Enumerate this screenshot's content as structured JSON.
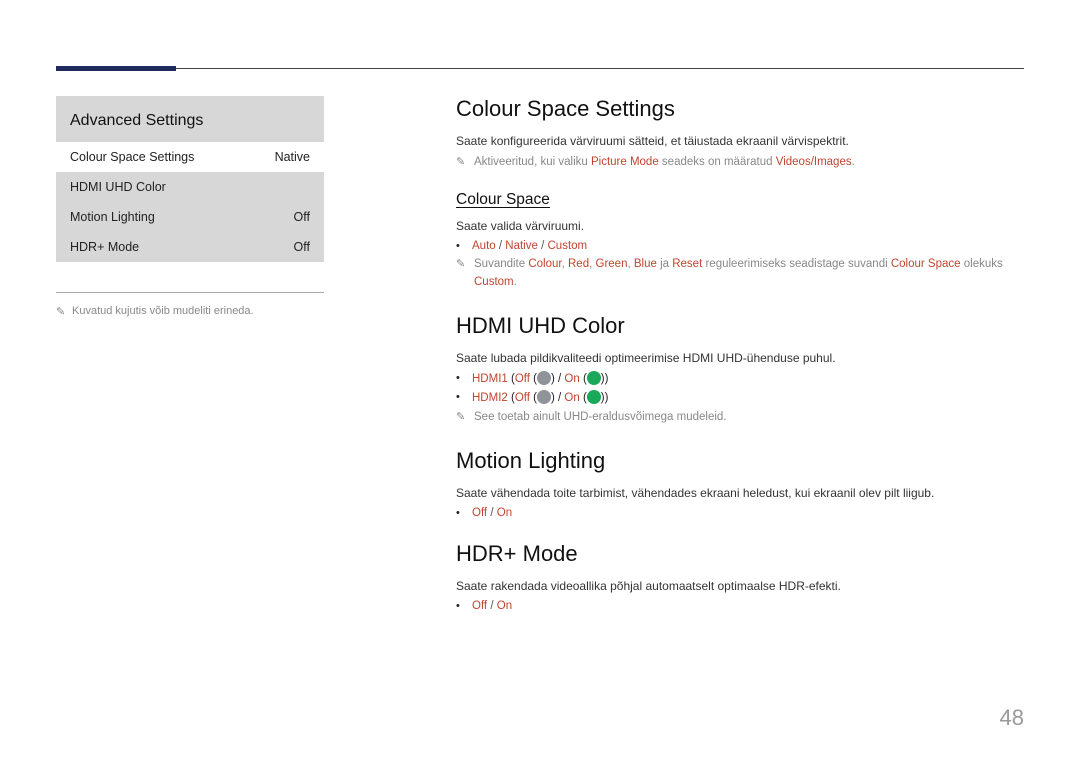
{
  "panel": {
    "title": "Advanced Settings",
    "rows": [
      {
        "label": "Colour Space Settings",
        "value": "Native"
      },
      {
        "label": "HDMI UHD Color",
        "value": ""
      },
      {
        "label": "Motion Lighting",
        "value": "Off"
      },
      {
        "label": "HDR+ Mode",
        "value": "Off"
      }
    ],
    "footnote": "Kuvatud kujutis võib mudeliti erineda."
  },
  "sections": {
    "css": {
      "title": "Colour Space Settings",
      "desc": "Saate konfigureerida värviruumi sätteid, et täiustada ekraanil värvispektrit.",
      "note_pre": "Aktiveeritud, kui valiku ",
      "note_mid1": "Picture Mode",
      "note_mid2": " seadeks on määratud ",
      "note_end": "Videos/Images",
      "sub": {
        "title": "Colour Space",
        "desc": "Saate valida värviruumi.",
        "opts": {
          "a": "Auto",
          "b": "Native",
          "c": "Custom"
        },
        "note_pre": "Suvandite ",
        "w1": "Colour",
        "w2": "Red",
        "w3": "Green",
        "w4": "Blue",
        "note_mid": " ja ",
        "w5": "Reset",
        "note_tail": " reguleerimiseks seadistage suvandi ",
        "w6": "Colour Space",
        "note_tail2": " olekuks ",
        "w7": "Custom"
      }
    },
    "hdmi": {
      "title": "HDMI UHD Color",
      "desc": "Saate lubada pildikvaliteedi optimeerimise HDMI UHD-ühenduse puhul.",
      "l1": "HDMI1",
      "l2": "HDMI2",
      "off": "Off",
      "on": "On",
      "note": "See toetab ainult UHD-eraldusvõimega mudeleid."
    },
    "ml": {
      "title": "Motion Lighting",
      "desc": "Saate vähendada toite tarbimist, vähendades ekraani heledust, kui ekraanil olev pilt liigub.",
      "off": "Off",
      "on": "On"
    },
    "hdr": {
      "title": "HDR+ Mode",
      "desc": "Saate rakendada videoallika põhjal automaatselt optimaalse HDR-efekti.",
      "off": "Off",
      "on": "On"
    }
  },
  "page_number": "48"
}
